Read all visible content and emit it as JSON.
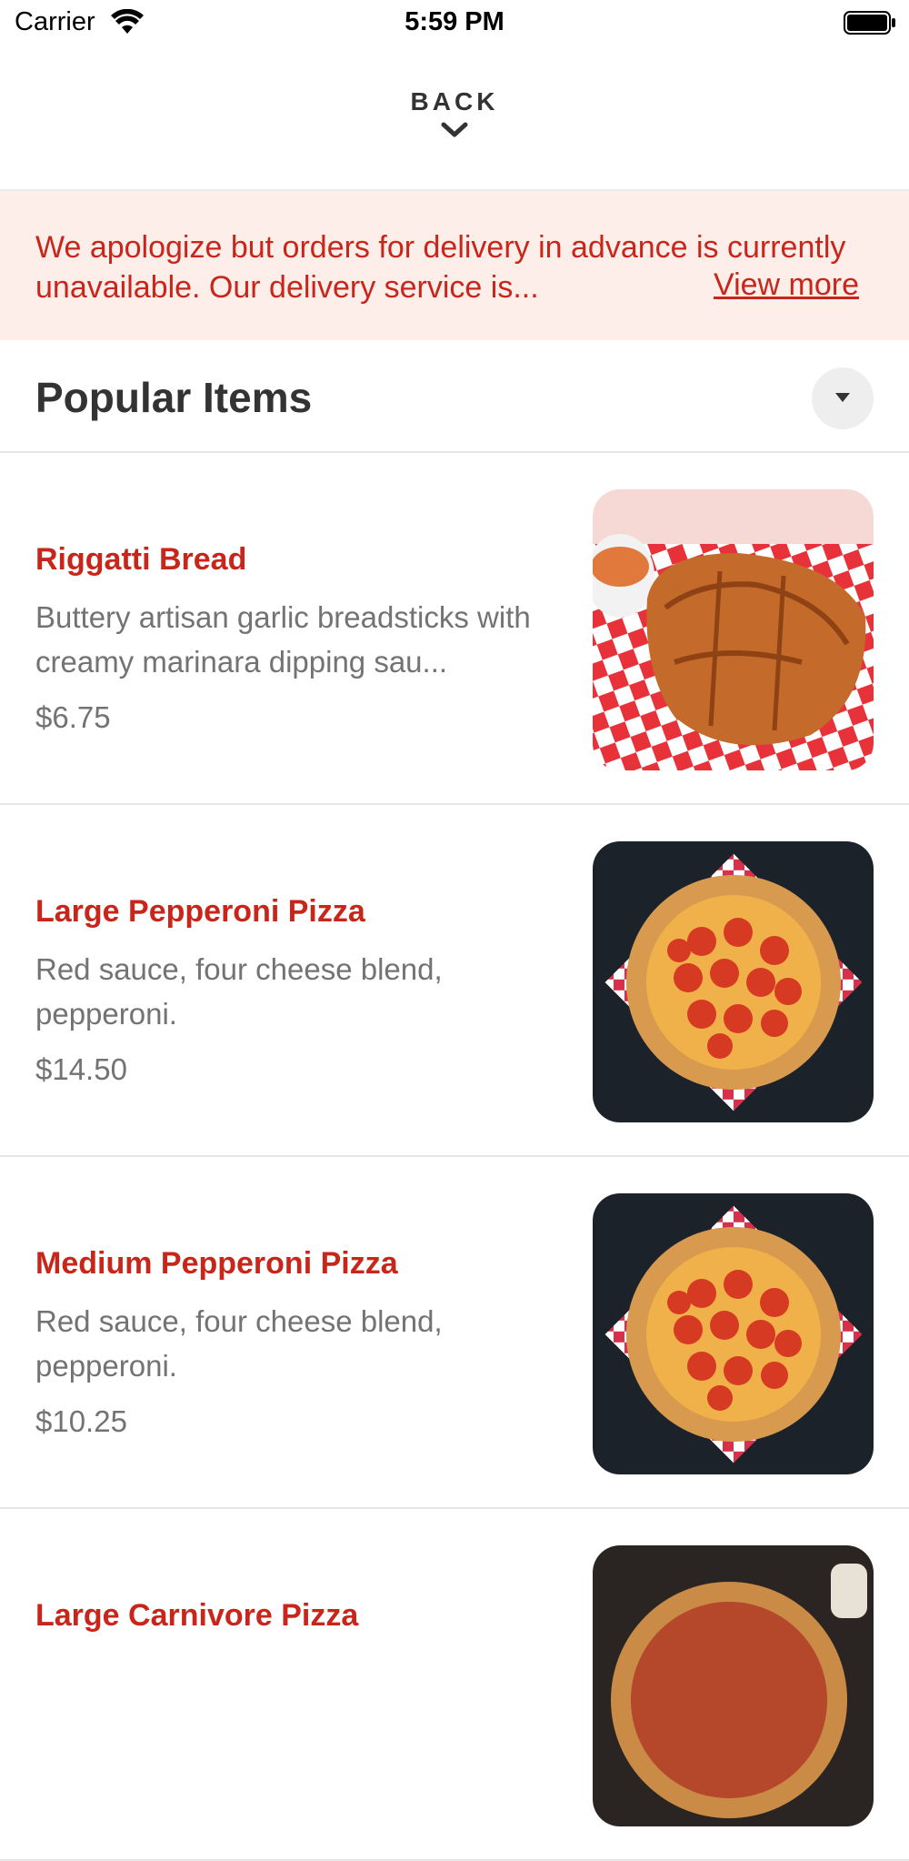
{
  "status_bar": {
    "carrier": "Carrier",
    "time": "5:59 PM"
  },
  "header": {
    "back_label": "BACK"
  },
  "banner": {
    "message": "We apologize but orders for delivery in advance is currently unavailable. Our delivery service is...",
    "link": "View more"
  },
  "section": {
    "title": "Popular Items"
  },
  "items": [
    {
      "name": "Riggatti Bread",
      "description": "Buttery artisan garlic breadsticks with creamy marinara dipping sau...",
      "price": "$6.75"
    },
    {
      "name": "Large Pepperoni Pizza",
      "description": "Red sauce, four cheese blend, pepperoni.",
      "price": "$14.50"
    },
    {
      "name": "Medium Pepperoni Pizza",
      "description": "Red sauce, four cheese blend, pepperoni.",
      "price": "$10.25"
    },
    {
      "name": "Large Carnivore Pizza"
    }
  ],
  "colors": {
    "accent": "#c8261b",
    "banner_bg": "#fdeeea",
    "muted_text": "#737373"
  }
}
